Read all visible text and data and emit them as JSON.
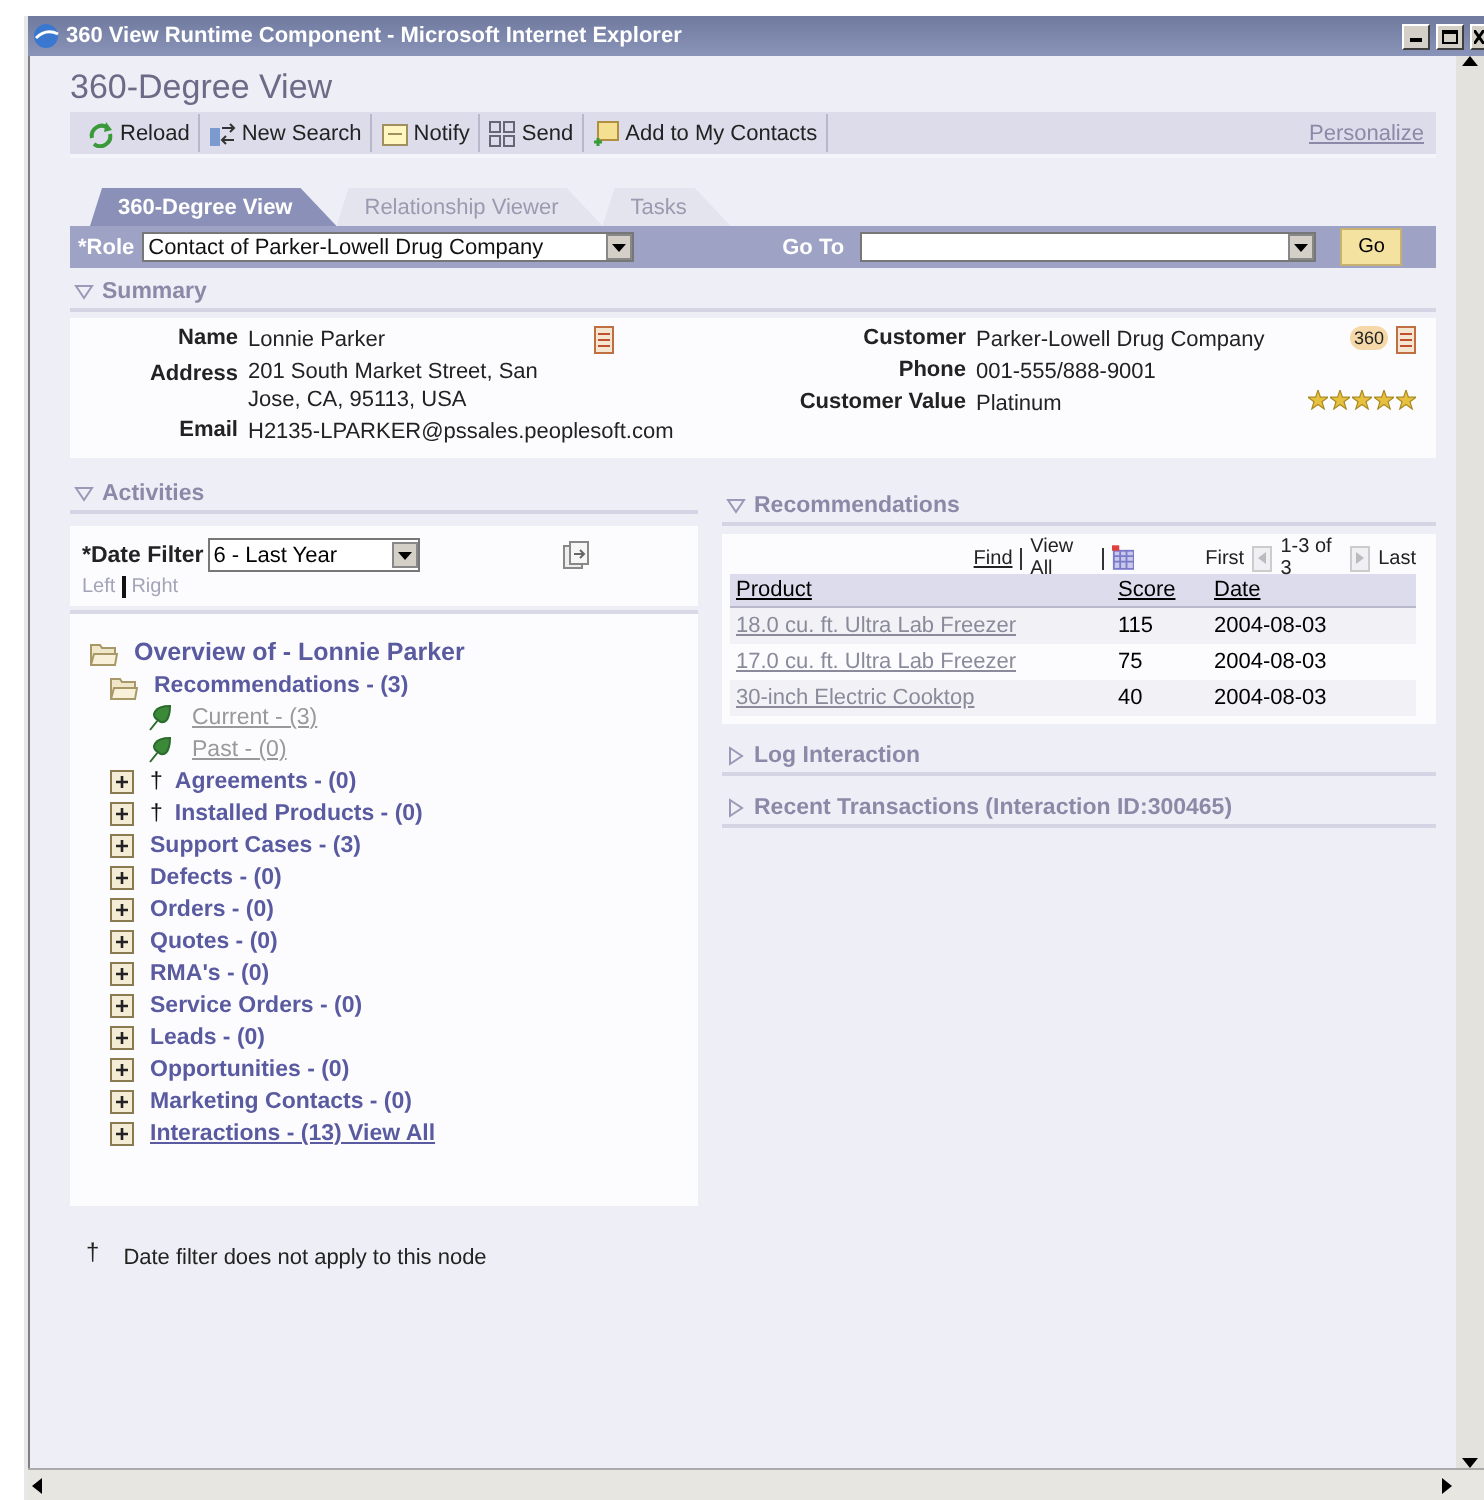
{
  "window": {
    "title": "360 View Runtime Component - Microsoft Internet Explorer"
  },
  "page_title": "360-Degree View",
  "toolbar": {
    "buttons": [
      {
        "label": "Reload",
        "kind": "reload"
      },
      {
        "label": "New Search",
        "kind": "search"
      },
      {
        "label": "Notify",
        "kind": "notify"
      },
      {
        "label": "Send",
        "kind": "send"
      },
      {
        "label": "Add to My Contacts",
        "kind": "contact"
      }
    ],
    "personalize": "Personalize"
  },
  "tabs": [
    {
      "label": "360-Degree View",
      "selected": true
    },
    {
      "label": "Relationship Viewer",
      "selected": false
    },
    {
      "label": "Tasks",
      "selected": false
    }
  ],
  "role_bar": {
    "role_label": "*Role",
    "role_value": "Contact of Parker-Lowell Drug Company",
    "goto_label": "Go To",
    "go_button": "Go"
  },
  "summary": {
    "title": "Summary",
    "expanded": true,
    "left": [
      {
        "label": "Name",
        "value": "Lonnie Parker"
      },
      {
        "label": "Address",
        "value": "201 South Market Street, San Jose, CA, 95113, USA"
      },
      {
        "label": "Email",
        "value": "H2135-LPARKER@pssales.peoplesoft.com"
      }
    ],
    "right": [
      {
        "label": "Customer",
        "value": "Parker-Lowell Drug Company"
      },
      {
        "label": "Phone",
        "value": "001-555/888-9001"
      },
      {
        "label": "Customer Value",
        "value": "Platinum"
      }
    ],
    "badge": "360",
    "stars": 5
  },
  "activities": {
    "title": "Activities",
    "expanded": true,
    "date_filter_label": "*Date Filter",
    "date_filter_value": "6 - Last Year",
    "left": "Left",
    "right": "Right",
    "tree": [
      {
        "label": "Overview of - Lonnie Parker",
        "kind": "folder",
        "expanded": true,
        "children": [
          {
            "label": "Recommendations - (3)",
            "kind": "folder",
            "expanded": true,
            "children": [
              {
                "label": "Current - (3)",
                "kind": "leaf"
              },
              {
                "label": "Past - (0)",
                "kind": "leaf"
              }
            ]
          },
          {
            "label": "Agreements - (0)",
            "kind": "folder",
            "expanded": false,
            "mark": "†"
          },
          {
            "label": "Installed Products - (0)",
            "kind": "folder",
            "expanded": false,
            "mark": "†"
          },
          {
            "label": "Support Cases - (3)",
            "kind": "folder",
            "expanded": false
          },
          {
            "label": "Defects - (0)",
            "kind": "folder",
            "expanded": false
          },
          {
            "label": "Orders - (0)",
            "kind": "folder",
            "expanded": false
          },
          {
            "label": "Quotes - (0)",
            "kind": "folder",
            "expanded": false
          },
          {
            "label": "RMA's - (0)",
            "kind": "folder",
            "expanded": false
          },
          {
            "label": "Service Orders - (0)",
            "kind": "folder",
            "expanded": false
          },
          {
            "label": "Leads - (0)",
            "kind": "folder",
            "expanded": false
          },
          {
            "label": "Opportunities - (0)",
            "kind": "folder",
            "expanded": false
          },
          {
            "label": "Marketing Contacts - (0)",
            "kind": "folder",
            "expanded": false
          },
          {
            "label": "Interactions - (13) View All",
            "kind": "folder",
            "expanded": false,
            "link": true
          }
        ]
      }
    ],
    "footnote_mark": "†",
    "footnote": "Date filter does not apply to this node"
  },
  "recommendations": {
    "title": "Recommendations",
    "expanded": true,
    "find": "Find",
    "view_all": "View All",
    "first": "First",
    "range": "1-3 of 3",
    "last": "Last",
    "columns": [
      "Product",
      "Score",
      "Date"
    ],
    "rows": [
      [
        "18.0 cu. ft. Ultra Lab Freezer",
        "115",
        "2004-08-03"
      ],
      [
        "17.0 cu. ft. Ultra Lab Freezer",
        "75",
        "2004-08-03"
      ],
      [
        "30-inch Electric Cooktop",
        "40",
        "2004-08-03"
      ]
    ]
  },
  "sections": [
    {
      "title": "Log Interaction",
      "expanded": false
    },
    {
      "title": "Recent Transactions (Interaction ID:300465)",
      "expanded": false
    }
  ]
}
